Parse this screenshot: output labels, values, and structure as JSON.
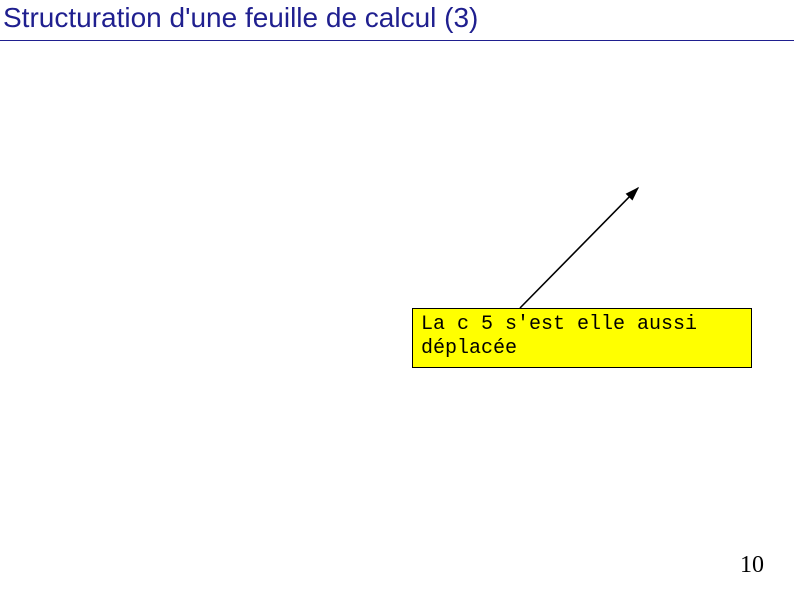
{
  "slide": {
    "title": "Structuration d'une feuille de calcul (3)",
    "callout_line1": "La c 5 s'est elle aussi",
    "callout_line2": "déplacée",
    "page_number": "10"
  }
}
